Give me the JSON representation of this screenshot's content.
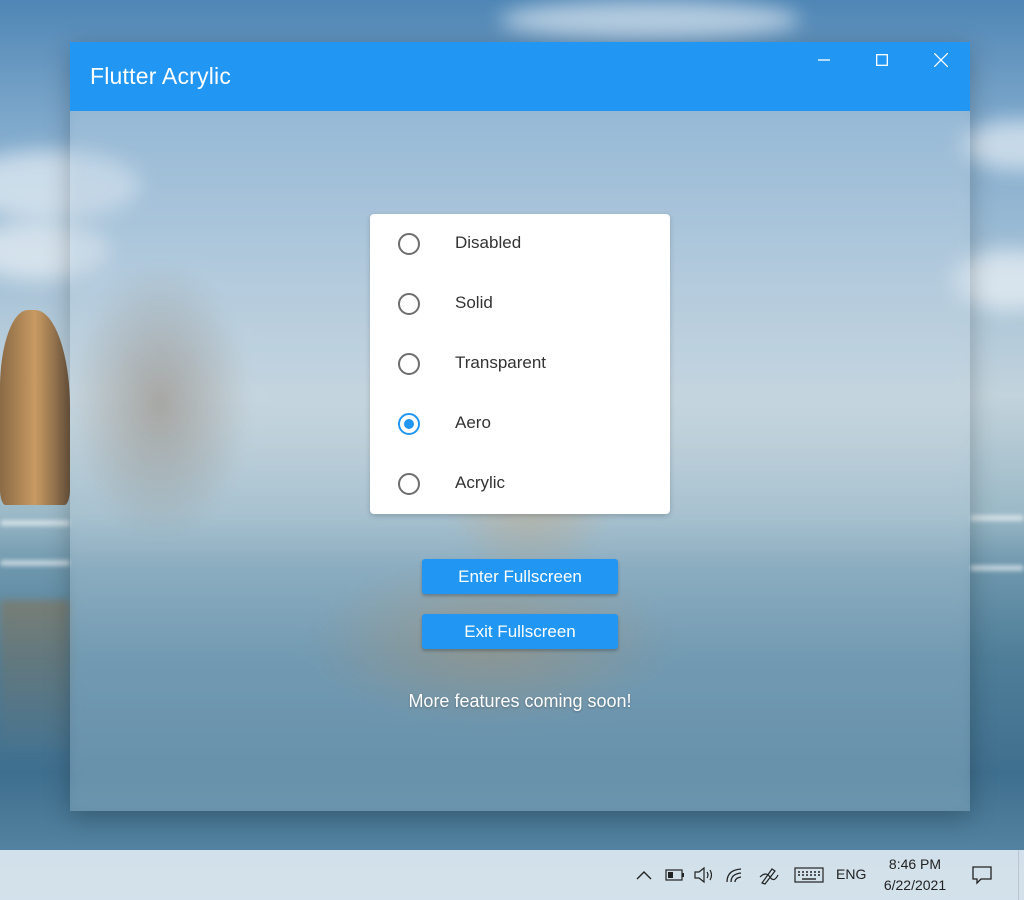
{
  "window": {
    "title": "Flutter Acrylic"
  },
  "effects": {
    "options": [
      {
        "label": "Disabled",
        "selected": false
      },
      {
        "label": "Solid",
        "selected": false
      },
      {
        "label": "Transparent",
        "selected": false
      },
      {
        "label": "Aero",
        "selected": true
      },
      {
        "label": "Acrylic",
        "selected": false
      }
    ]
  },
  "actions": {
    "enter_fullscreen": "Enter Fullscreen",
    "exit_fullscreen": "Exit Fullscreen"
  },
  "footer": {
    "note": "More features coming soon!"
  },
  "taskbar": {
    "language": "ENG",
    "time": "8:46 PM",
    "date": "6/22/2021"
  },
  "colors": {
    "accent": "#2196f3"
  }
}
